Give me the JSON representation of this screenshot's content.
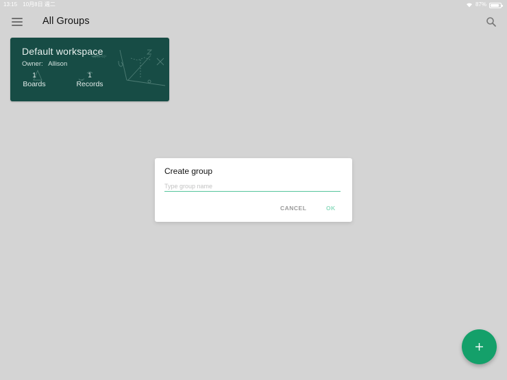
{
  "status_bar": {
    "time": "13:15",
    "date": "10月8日 週二",
    "battery": "87%",
    "battery_level": 0.87
  },
  "header": {
    "title": "All Groups",
    "menu_icon": "hamburger-menu-icon",
    "search_icon": "search-icon"
  },
  "workspace_card": {
    "title": "Default workspace",
    "owner_label": "Owner:",
    "owner_name": "Allison",
    "boards_count": "1",
    "boards_label": "Boards",
    "records_count": "1",
    "records_label": "Records"
  },
  "dialog": {
    "title": "Create group",
    "input_value": "",
    "input_placeholder": "Type group name",
    "cancel_label": "CANCEL",
    "ok_label": "OK"
  },
  "fab": {
    "icon": "plus-icon"
  },
  "colors": {
    "background": "#d4d4d4",
    "card": "#174c45",
    "accent": "#14a06a",
    "input_underline": "#53c49a",
    "ok_disabled": "#8fdcbf"
  }
}
